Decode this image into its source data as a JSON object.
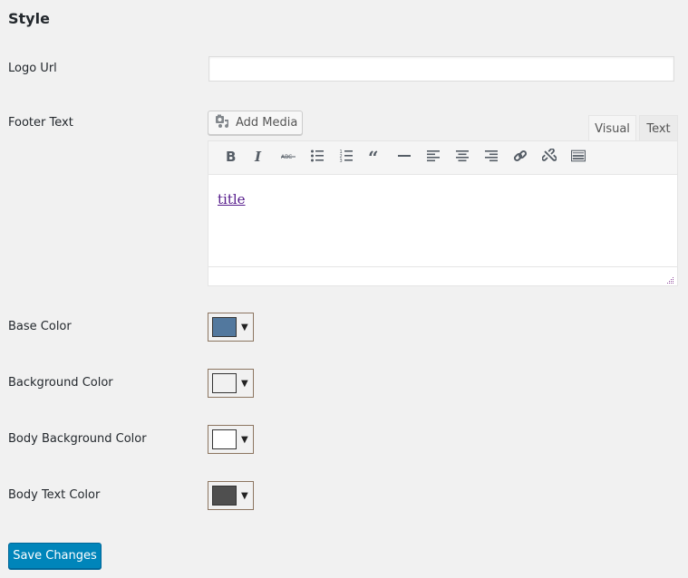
{
  "section_title": "Style",
  "fields": {
    "logo_url": {
      "label": "Logo Url",
      "value": "",
      "placeholder": ""
    },
    "footer_text": {
      "label": "Footer Text",
      "add_media_label": "Add Media",
      "tabs": {
        "visual": "Visual",
        "text": "Text",
        "active": "Visual"
      },
      "toolbar": [
        "bold-icon",
        "italic-icon",
        "strikethrough-icon",
        "bulleted-list-icon",
        "numbered-list-icon",
        "blockquote-icon",
        "horizontal-rule-icon",
        "align-left-icon",
        "align-center-icon",
        "align-right-icon",
        "link-icon",
        "unlink-icon",
        "keyboard-icon"
      ],
      "content_link_text": "title"
    },
    "base_color": {
      "label": "Base Color",
      "value": "#52789e"
    },
    "background_color": {
      "label": "Background Color",
      "value": "#f1f1f1"
    },
    "body_background_color": {
      "label": "Body Background Color",
      "value": "#ffffff"
    },
    "body_text_color": {
      "label": "Body Text Color",
      "value": "#4f4f4f"
    }
  },
  "actions": {
    "save_label": "Save Changes"
  },
  "colors": {
    "primary_button": "#0085ba",
    "page_background": "#f1f1f1"
  }
}
